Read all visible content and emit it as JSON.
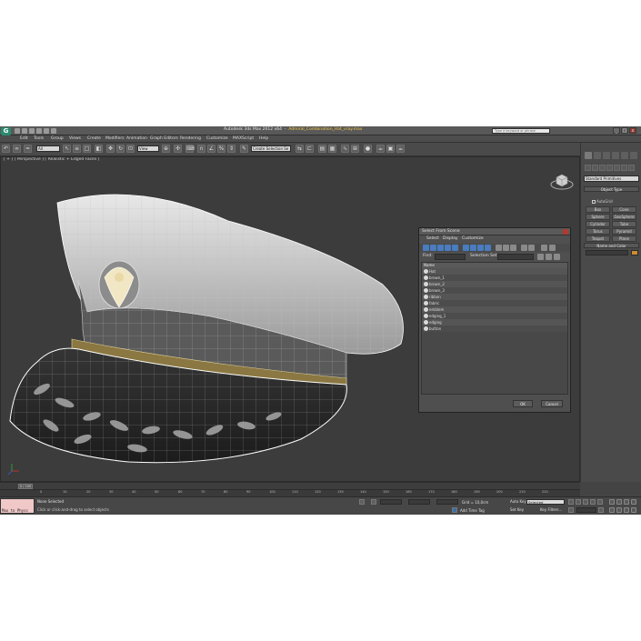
{
  "app": {
    "title_app": "Autodesk 3ds Max 2012 x64",
    "title_file": "Admiral_Combination_Hat_vray.max",
    "search_placeholder": "Type a keyword or phrase",
    "menu": [
      "Edit",
      "Tools",
      "Group",
      "Views",
      "Create",
      "Modifiers",
      "Animation",
      "Graph Editors",
      "Rendering",
      "Customize",
      "MAXScript",
      "Help"
    ]
  },
  "toolbar": {
    "filter_value": "All",
    "ref_coord_value": "View",
    "selection_set_value": "Create Selection Se"
  },
  "viewport": {
    "label": "[ + ] [ Perspective ] [ Realistic + Edged Faces ]"
  },
  "dialog": {
    "title": "Select From Scene",
    "menu": [
      "Select",
      "Display",
      "Customize"
    ],
    "find_label": "Find:",
    "selection_set_label": "Selection Set:",
    "list_header": "Name",
    "items": [
      "Hat",
      "brown_1",
      "brown_2",
      "brown_3",
      "ribbon",
      "fabric",
      "emblem",
      "edging_1",
      "edging",
      "button"
    ],
    "ok": "OK",
    "cancel": "Cancel"
  },
  "command_panel": {
    "dropdown_value": "Standard Primitives",
    "object_type_header": "Object Type",
    "autogrid_label": "AutoGrid",
    "buttons": [
      "Box",
      "Cone",
      "Sphere",
      "GeoSphere",
      "Cylinder",
      "Tube",
      "Torus",
      "Pyramid",
      "Teapot",
      "Plane"
    ],
    "name_color_header": "Name and Color"
  },
  "timeline": {
    "frame_display": "0 / 100",
    "ticks": [
      "0",
      "10",
      "20",
      "30",
      "40",
      "50",
      "60",
      "70",
      "80",
      "90",
      "100",
      "110",
      "120",
      "130",
      "140",
      "150",
      "160",
      "170",
      "180",
      "190",
      "200",
      "210",
      "220"
    ]
  },
  "status": {
    "maxscript_label": "Max to Physc",
    "selection_text": "None Selected",
    "prompt_text": "Click or click-and-drag to select objects",
    "grid_label": "Grid = 10,0cm",
    "add_time_tag": "Add Time Tag",
    "auto_key": "Auto Key",
    "selected_value": "Selected",
    "set_key": "Set Key",
    "key_filters": "Key Filters..."
  },
  "colors": {
    "viewport_bg": "#3c3c3c",
    "ui_bg": "#444444",
    "object_color_swatch": "#d08a32",
    "maxscript_bg": "#f0c8c8"
  }
}
